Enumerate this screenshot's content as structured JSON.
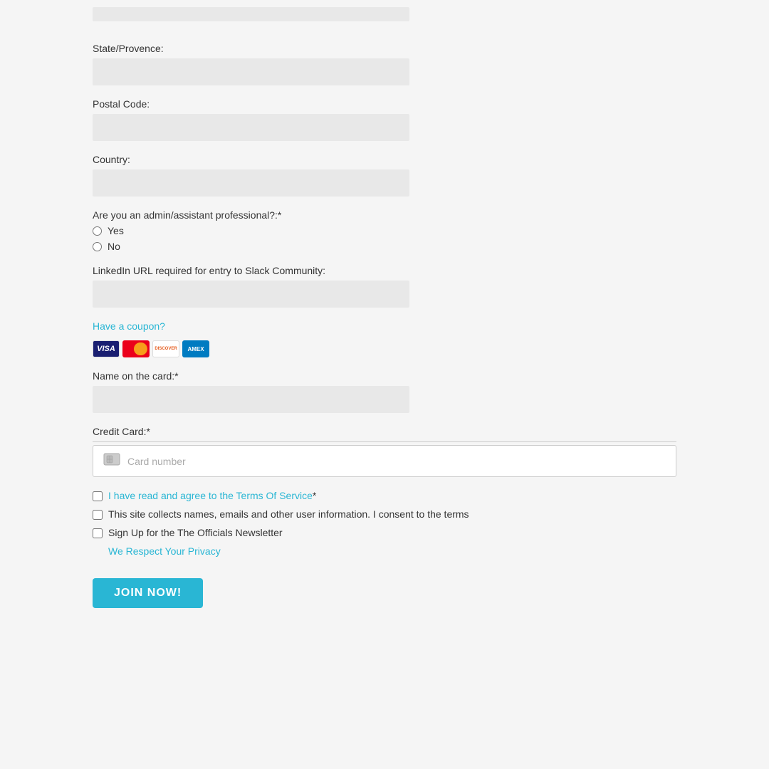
{
  "form": {
    "fields": {
      "state_province": {
        "label": "State/Provence:",
        "placeholder": ""
      },
      "postal_code": {
        "label": "Postal Code:",
        "placeholder": ""
      },
      "country": {
        "label": "Country:",
        "placeholder": ""
      },
      "admin_question": {
        "label": "Are you an admin/assistant professional?:*",
        "options": [
          "Yes",
          "No"
        ]
      },
      "linkedin_url": {
        "label": "LinkedIn URL required for entry to Slack Community:",
        "placeholder": ""
      },
      "coupon": {
        "link_text": "Have a coupon?"
      },
      "name_on_card": {
        "label": "Name on the card:*",
        "placeholder": ""
      },
      "credit_card": {
        "label": "Credit Card:*",
        "placeholder": "Card number"
      }
    },
    "checkboxes": {
      "terms": {
        "link_text": "I have read and agree to the Terms Of Service",
        "suffix": "*",
        "checked": false
      },
      "consent": {
        "text": "This site collects names, emails and other user information. I consent to the terms",
        "checked": false
      },
      "newsletter": {
        "text": "Sign Up for the The Officials Newsletter",
        "checked": false
      }
    },
    "privacy_link": "We Respect Your Privacy",
    "submit_button": "JOIN NOW!"
  },
  "payment_icons": [
    {
      "name": "VISA",
      "type": "visa"
    },
    {
      "name": "MC",
      "type": "mastercard"
    },
    {
      "name": "DISCOVER",
      "type": "discover"
    },
    {
      "name": "AMEX",
      "type": "amex"
    }
  ]
}
